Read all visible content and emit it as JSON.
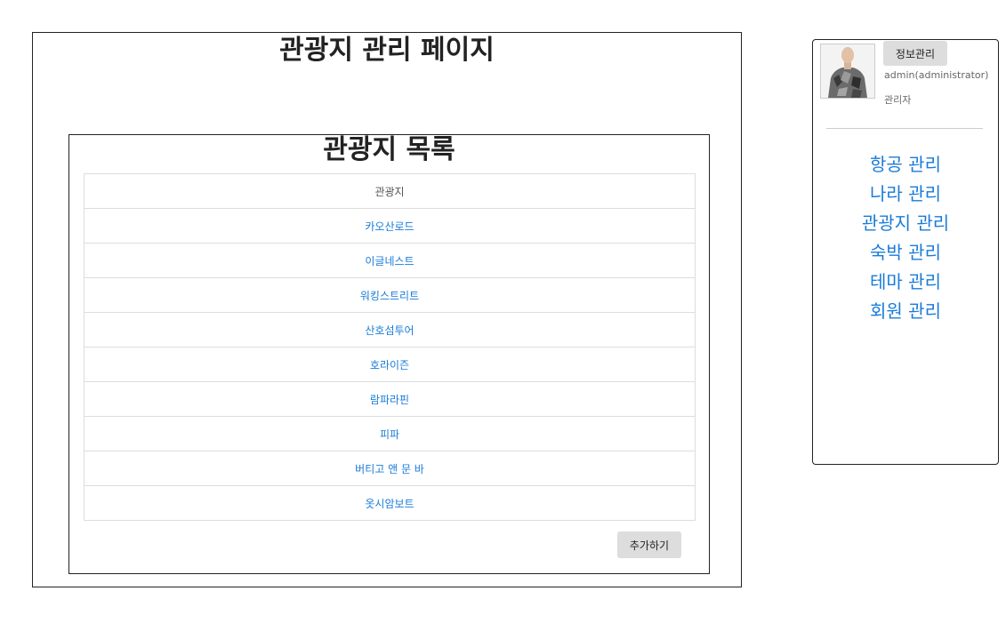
{
  "page": {
    "title": "관광지 관리 페이지"
  },
  "list": {
    "title": "관광지 목록",
    "column_header": "관광지",
    "rows": [
      "카오산로드",
      "이글네스트",
      "워킹스트리트",
      "산호섬투어",
      "호라이즌",
      "람파라핀",
      "피파",
      "버티고 앤 문 바",
      "옷시암보트"
    ],
    "add_label": "추가하기"
  },
  "sidebar": {
    "info_button": "정보관리",
    "user_name": "admin(administrator)",
    "user_role": "관리자",
    "menu": [
      "항공 관리",
      "나라 관리",
      "관광지 관리",
      "숙박 관리",
      "테마 관리",
      "회원 관리"
    ]
  },
  "colors": {
    "link": "#1a7bd8",
    "border": "#222222",
    "button_bg": "#dddddd",
    "table_border": "#dddddd"
  }
}
